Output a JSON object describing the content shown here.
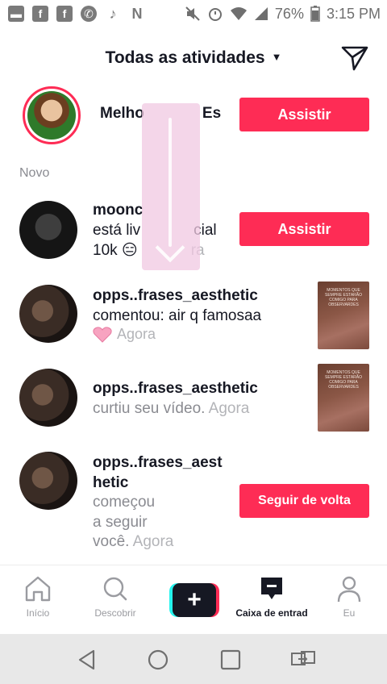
{
  "status_bar": {
    "notification_icons": [
      "message-icon",
      "facebook-icon",
      "facebook-icon",
      "whatsapp-icon",
      "tiktok-icon",
      "netflix-icon"
    ],
    "battery": "76%",
    "time": "3:15 PM"
  },
  "header": {
    "title": "Todas as atividades"
  },
  "live_friend": {
    "name": "Melho",
    "name_suffix": "Es",
    "button": "Assistir"
  },
  "section": {
    "label": "Novo"
  },
  "live_user": {
    "name": "moonc",
    "desc_line1_start": "está liv",
    "desc_line1_end": "cial",
    "viewers": "10k",
    "viewers_emoji": "😑",
    "time_fragment": "ra",
    "button": "Assistir"
  },
  "notifications": [
    {
      "username": "opps..frases_aesthetic",
      "text": "comentou: air q famosaa",
      "time": "Agora",
      "thumb_text": "MOMENTOS QUE SEMPRE ESTARÃO COMIGO PARA OBSERVARDES"
    },
    {
      "username": "opps..frases_aesthetic",
      "text": "curtiu seu vídeo.",
      "time": "Agora",
      "thumb_text": "MOMENTOS QUE SEMPRE ESTARÃO COMIGO PARA OBSERVARDES"
    },
    {
      "username_line1": "opps..frases_aest",
      "username_line2": "hetic",
      "text_line1": "começou",
      "text_line2": "a seguir",
      "text_line3": "você.",
      "time": "Agora",
      "button": "Seguir de volta"
    }
  ],
  "tabbar": {
    "home": "Início",
    "discover": "Descobrir",
    "create": "+",
    "inbox": "Caixa de entrad",
    "profile": "Eu"
  },
  "colors": {
    "accent": "#fe2c55",
    "cyan": "#25f4ee",
    "text": "#161823",
    "muted": "#8a8b91"
  }
}
